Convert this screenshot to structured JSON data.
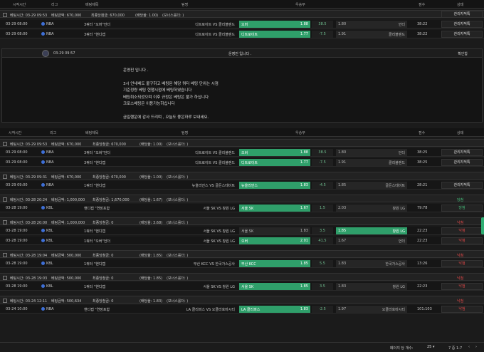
{
  "columns": {
    "start_time": "시작시간",
    "league": "리그",
    "bet_title": "베팅제목",
    "teams": "팀명",
    "win_draw_lose": "우승부",
    "score": "점수",
    "status": "상태"
  },
  "top_group": {
    "head": {
      "time": "03-29 09:53",
      "amount": "670,000",
      "label_time": "베팅시간:",
      "label_amount": "베팅금액:",
      "payout": "최종당첨금: 670,000",
      "odds": "(배당율: 1.00)",
      "bonus": "(보너스롤더: )",
      "status": "관리자적특"
    },
    "rows": [
      {
        "date": "03-29 08:00",
        "league": "NBA",
        "title": "3쿼터 \"오버\"언더",
        "teams": "디트로이트 VS 클리블랜드",
        "pick": "오버",
        "odds": "1.88",
        "line": "38.5",
        "odds2": "1.80",
        "other": "언더",
        "score": "38:22",
        "status": "관리자적특"
      },
      {
        "date": "03-29 08:00",
        "league": "NBA",
        "title": "3쿼터 \"핸디캡",
        "teams": "디트로이트 VS 클리블랜드",
        "pick": "디트로이트",
        "odds": "1.77",
        "line": "-7.5",
        "odds2": "1.91",
        "other": "클리블랜드",
        "score": "38:22",
        "status": "관리자적특"
      }
    ]
  },
  "notice": {
    "date": "03-29 09:57",
    "title": "운영진 입니다 .",
    "confirm": "확인함",
    "lines": [
      "운영진 입니다 .",
      "",
      "3시 언네베도 불구하고 베팅된 해당 쿼터 베팅 단위는 시점",
      "기준정량 베팅 현행시점에 베팅하였습니다",
      "베팅취소되셨으며 이후 규정은 베팅은 불가 하십니다",
      "크로스베팅은 이용가능하십니다",
      "",
      "금일행운에 감사 드리며 , 오늘도 좋은하루 보내세요."
    ]
  },
  "groups": [
    {
      "head": {
        "time": "03-29 09:53",
        "amount": "670,000",
        "payout": "최종당첨금: 670,000",
        "odds": "(배당율: 1.00)",
        "bonus": "(보너스롤더: )"
      },
      "rows": [
        {
          "date": "03-29 08:00",
          "league": "NBA",
          "title": "3쿼터 \"오버\"언더",
          "teams": "디트로이트 VS 클리블랜드",
          "pick": "오버",
          "odds": "1.88",
          "line": "38.5",
          "odds2": "1.80",
          "other": "언더",
          "score": "38:25",
          "status": "관리자적특",
          "pick_side": "left"
        },
        {
          "date": "03-29 08:00",
          "league": "NBA",
          "title": "3쿼터 \"핸디캡",
          "teams": "디트로이트 VS 클리블랜드",
          "pick": "디트로이트",
          "odds": "1.77",
          "line": "-7.5",
          "odds2": "1.91",
          "other": "클리블랜드",
          "score": "38:25",
          "status": "관리자적특",
          "pick_side": "left"
        }
      ]
    },
    {
      "head": {
        "time": "03-29 09:31",
        "amount": "670,000",
        "payout": "최종당첨금: 670,000",
        "odds": "(배당율: 1.00)",
        "bonus": "(보너스롤더: )"
      },
      "rows": [
        {
          "date": "03-29 09:00",
          "league": "NBA",
          "title": "1쿼터 \"핸디캡",
          "teams": "뉴올리언스 VS 골든스테이트",
          "pick": "뉴올리언스",
          "odds": "1.83",
          "line": "-4.5",
          "odds2": "1.85",
          "other": "골든스테이트",
          "score": "28:21",
          "status": "관리자적특",
          "pick_side": "left"
        }
      ]
    },
    {
      "head": {
        "time": "03-28 20:24",
        "amount": "1,000,000",
        "payout": "최종당첨금: 1,670,000",
        "odds": "(배당율: 1.67)",
        "bonus": "(보너스롤더: )"
      },
      "head_status": "당첨",
      "head_status_color": "green",
      "rows": [
        {
          "date": "03-28 19:00",
          "league": "KBL",
          "title": "핸디캡 \"연장포함",
          "teams": "서울 SK VS 창원 LG",
          "pick": "서울 SK",
          "odds": "1.67",
          "line": "1.5",
          "odds2": "2.03",
          "other": "창원 LG",
          "score": "79:78",
          "status": "당첨",
          "status_color": "green",
          "pick_side": "left"
        }
      ]
    },
    {
      "head": {
        "time": "03-28 20:00",
        "amount": "1,000,000",
        "payout": "최종당첨금: 0",
        "odds": "(배당율: 3.68)",
        "bonus": "(보너스롤더: )"
      },
      "head_status": "낙첨",
      "head_status_color": "red",
      "rows": [
        {
          "date": "03-28 19:00",
          "league": "KBL",
          "title": "1쿼터 \"핸디캡",
          "teams": "서울 SK VS 창원 LG",
          "pick": "창원 LG",
          "odds": "1.83",
          "line": "3.5",
          "odds2": "1.85",
          "other": "서울 SK",
          "score": "22:23",
          "status": "낙첨",
          "status_color": "red",
          "pick_side": "right"
        },
        {
          "date": "03-28 19:00",
          "league": "KBL",
          "title": "1쿼터 \"오버\"언더",
          "teams": "서울 SK VS 창원 LG",
          "pick": "오버",
          "odds": "2.01",
          "line": "41.5",
          "odds2": "1.67",
          "other": "언더",
          "score": "22:23",
          "status": "낙첨",
          "status_color": "red",
          "pick_side": "left"
        }
      ]
    },
    {
      "head": {
        "time": "03-28 19:04",
        "amount": "500,000",
        "payout": "최종당첨금: 0",
        "odds": "(배당율: 1.85)",
        "bonus": "(보너스롤더: )"
      },
      "head_status": "낙첨",
      "head_status_color": "red",
      "rows": [
        {
          "date": "03-28 19:00",
          "league": "KBL",
          "title": "1쿼터 \"핸디캡",
          "teams": "부산 KCC VS 한국가스공사",
          "pick": "부산 KCC",
          "odds": "1.85",
          "line": "5.5",
          "odds2": "1.83",
          "other": "한국가스공사",
          "score": "13:26",
          "status": "낙첨",
          "status_color": "red",
          "pick_side": "left"
        }
      ]
    },
    {
      "head": {
        "time": "03-28 19:03",
        "amount": "500,000",
        "payout": "최종당첨금: 0",
        "odds": "(배당율: 1.85)",
        "bonus": "(보너스롤더: )"
      },
      "head_status": "낙첨",
      "head_status_color": "red",
      "rows": [
        {
          "date": "03-28 19:00",
          "league": "KBL",
          "title": "1쿼터 \"핸디캡",
          "teams": "서울 SK VS 창원 LG",
          "pick": "서울 SK",
          "odds": "1.85",
          "line": "3.5",
          "odds2": "1.83",
          "other": "창원 LG",
          "score": "22:23",
          "status": "낙첨",
          "status_color": "red",
          "pick_side": "left"
        }
      ]
    },
    {
      "head": {
        "time": "03-24 12:11",
        "amount": "500,634",
        "payout": "최종당첨금: 0",
        "odds": "(배당율: 1.83)",
        "bonus": "(보너스롤더: )"
      },
      "head_status": "낙첨",
      "head_status_color": "red",
      "rows": [
        {
          "date": "03-24 10:00",
          "league": "NBA",
          "title": "핸디캡 \"연장포함",
          "teams": "LA 클리퍼스 VS 오클라호마시티",
          "pick": "LA 클리퍼스",
          "odds": "1.83",
          "line": "-2.5",
          "odds2": "1.97",
          "other": "오클라호마시티",
          "score": "101:103",
          "status": "낙첨",
          "status_color": "red",
          "pick_side": "left"
        }
      ]
    }
  ],
  "footer": {
    "per_page_label": "페이지 당 개수:",
    "per_page_value": "25",
    "page_info": "7 중 1-7"
  },
  "colors": {
    "accent": "#2f9f6a",
    "win": "#45c17c",
    "lose": "#e04848",
    "bg": "#1b1b1b"
  }
}
